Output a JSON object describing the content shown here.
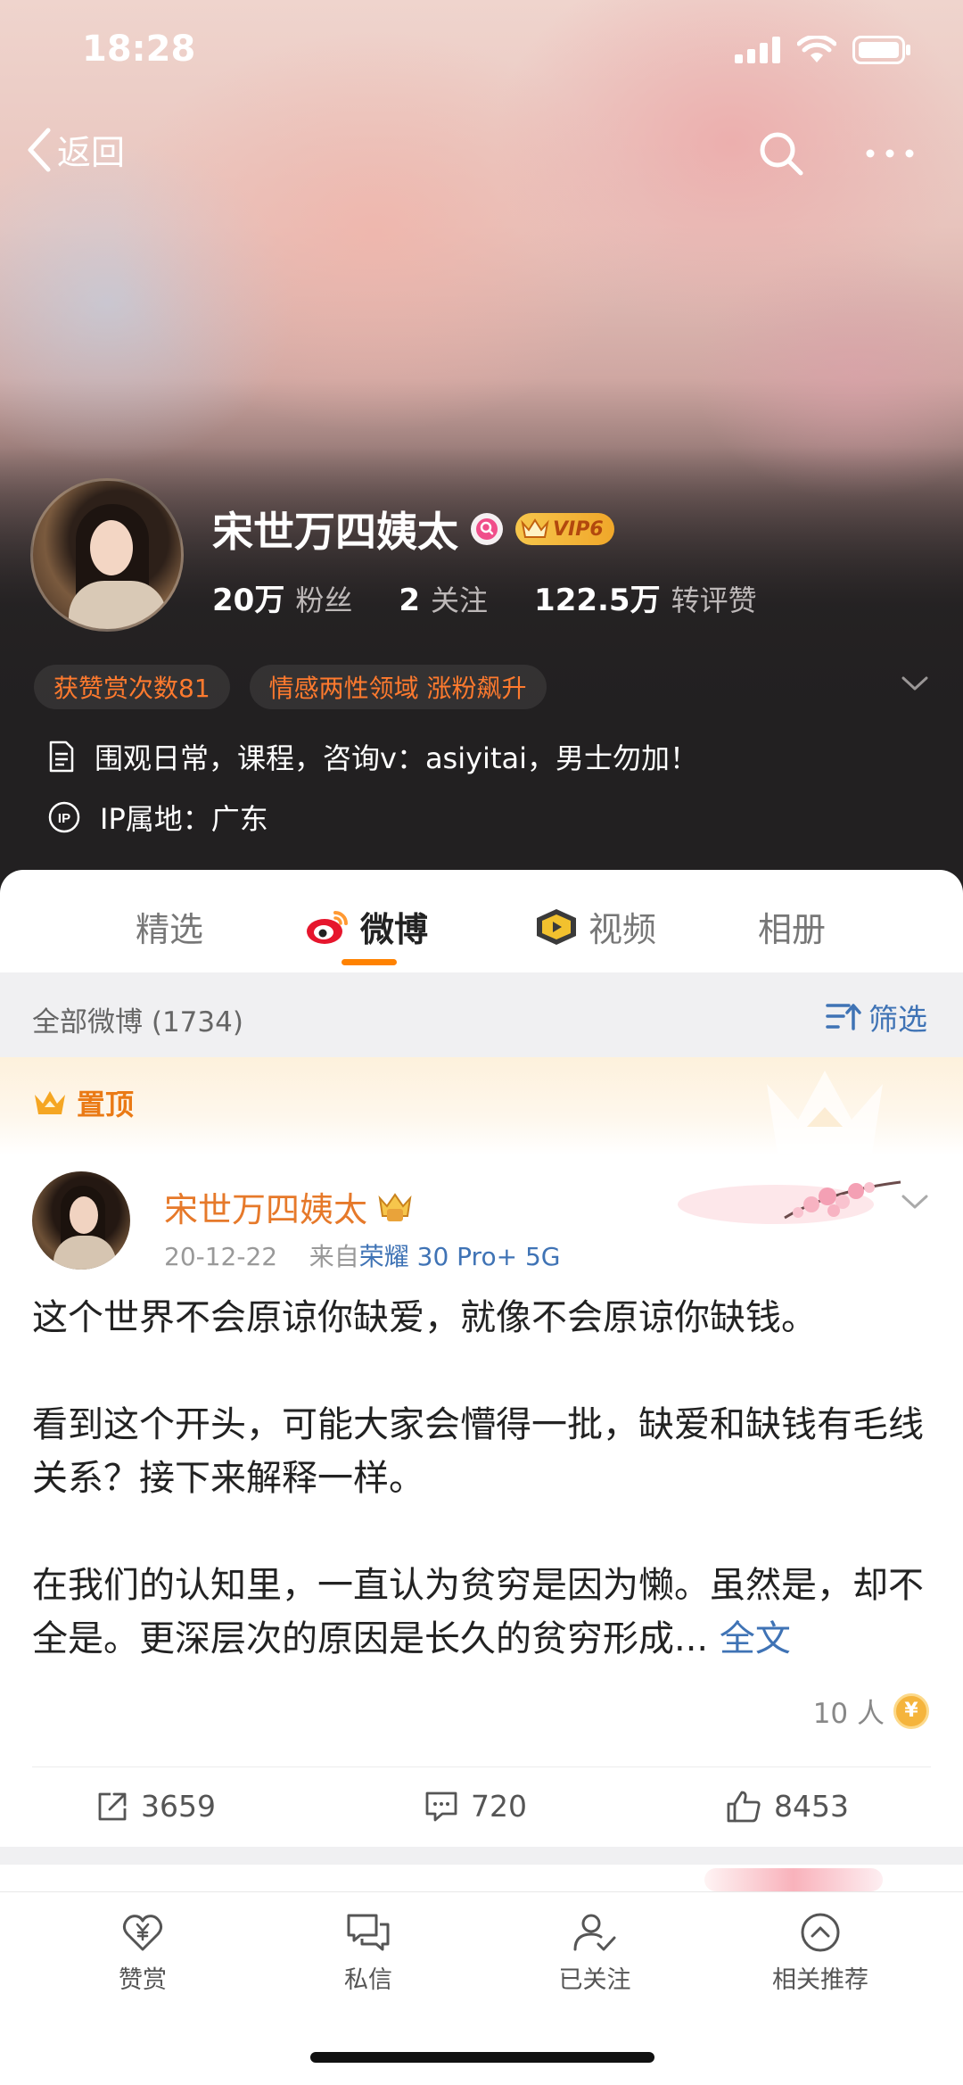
{
  "status_bar": {
    "time": "18:28"
  },
  "nav": {
    "back_label": "返回"
  },
  "profile": {
    "name": "宋世万四姨太",
    "vip_label": "VIP6",
    "stats": [
      {
        "value": "20万",
        "label": "粉丝"
      },
      {
        "value": "2",
        "label": "关注"
      },
      {
        "value": "122.5万",
        "label": "转评赞"
      }
    ],
    "tags": [
      "获赞赏次数81",
      "情感两性领域 涨粉飙升"
    ],
    "bio": "围观日常，课程，咨询v：asiyitai，男士勿加！",
    "ip_location": "IP属地：广东",
    "ip_icon_text": "IP"
  },
  "tabs": [
    {
      "label": "精选"
    },
    {
      "label": "微博"
    },
    {
      "label": "视频"
    },
    {
      "label": "相册"
    }
  ],
  "filter": {
    "title": "全部微博 (1734)",
    "button_label": "筛选"
  },
  "pinned": {
    "label": "置顶",
    "author": "宋世万四姨太",
    "date": "20-12-22",
    "source_prefix": "来自",
    "source": "荣耀 30 Pro+ 5G",
    "paragraphs": [
      "这个世界不会原谅你缺爱，就像不会原谅你缺钱。",
      "看到这个开头，可能大家会懵得一批，缺爱和缺钱有毛线关系？接下来解释一样。",
      "在我们的认知里，一直认为贫穷是因为懒。虽然是，却不全是。更深层次的原因是长久的贫穷形成..."
    ],
    "full_text_link": "全文",
    "reward_count": "10 人",
    "reward_icon_text": "¥",
    "reposts": "3659",
    "comments": "720",
    "likes": "8453"
  },
  "bottom_bar": {
    "items": [
      {
        "label": "赞赏",
        "icon": "heart-yuan-icon"
      },
      {
        "label": "私信",
        "icon": "chat-icon"
      },
      {
        "label": "已关注",
        "icon": "user-check-icon"
      },
      {
        "label": "相关推荐",
        "icon": "chevron-up-circle-icon"
      }
    ]
  },
  "colors": {
    "accent_orange": "#ff8200",
    "link_blue": "#3f73b5",
    "tag_orange": "#ff7a2e",
    "author_orange": "#e6792a"
  }
}
